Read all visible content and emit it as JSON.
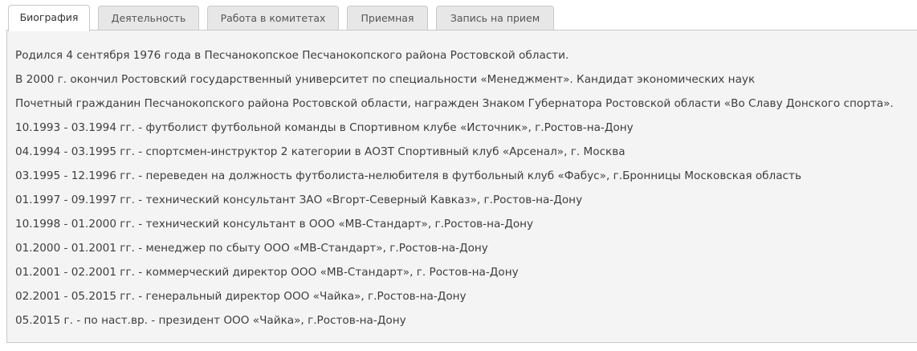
{
  "tabs": [
    {
      "label": "Биография",
      "active": true
    },
    {
      "label": "Деятельность",
      "active": false
    },
    {
      "label": "Работа в комитетах",
      "active": false
    },
    {
      "label": "Приемная",
      "active": false
    },
    {
      "label": "Запись на прием",
      "active": false
    }
  ],
  "biography": {
    "lines": [
      "Родился 4 сентября 1976 года в Песчанокопское Песчанокопского района Ростовской области.",
      "В 2000 г. окончил Ростовский государственный университет по специальности «Менеджмент». Кандидат экономических наук",
      "Почетный гражданин Песчанокопского района Ростовской области, награжден Знаком Губернатора Ростовской области «Во Славу Донского спорта».",
      "10.1993 - 03.1994 гг. - футболист футбольной команды в Спортивном клубе «Источник», г.Ростов-на-Дону",
      "04.1994 - 03.1995 гг. - спортсмен-инструктор 2 категории в АОЗТ Спортивный клуб «Арсенал», г. Москва",
      "03.1995 - 12.1996 гг. - переведен на должность футболиста-нелюбителя в  футбольный клуб «Фабус», г.Бронницы Московская область",
      "01.1997 - 09.1997 гг. - технический консультант ЗАО «Вгорт-Северный Кавказ», г.Ростов-на-Дону",
      "10.1998 - 01.2000 гг. - технический консультант в ООО «МВ-Стандарт», г.Ростов-на-Дону",
      "01.2000 - 01.2001 гг. - менеджер по сбыту ООО «МВ-Стандарт», г.Ростов-на-Дону",
      "01.2001 - 02.2001 гг. - коммерческий директор ООО «МВ-Стандарт», г. Ростов-на-Дону",
      "02.2001 - 05.2015 гг. - генеральный директор ООО «Чайка», г.Ростов-на-Дону",
      "05.2015 г. - по наст.вр. - президент ООО «Чайка», г.Ростов-на-Дону"
    ]
  }
}
